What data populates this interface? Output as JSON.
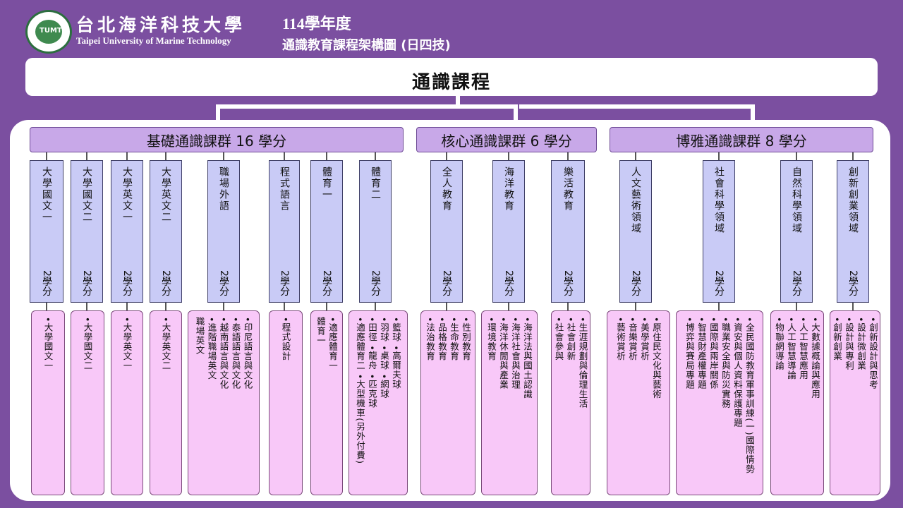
{
  "header": {
    "logo_text": "TUMT",
    "university_cn": "台北海洋科技大學",
    "university_en": "Taipei University of Marine Technology",
    "year": "114學年度",
    "subtitle": "通識教育課程架構圖 (日四技)"
  },
  "main_title": "通識課程",
  "categories": [
    {
      "label": "基礎通識課群 16 學分"
    },
    {
      "label": "核心通識課群 6 學分"
    },
    {
      "label": "博雅通識課群 8 學分"
    }
  ],
  "columns": [
    {
      "name": "大學國文一",
      "credit": "2學分",
      "courses": [
        "•大學國文一"
      ]
    },
    {
      "name": "大學國文二",
      "credit": "2學分",
      "courses": [
        "•大學國文二"
      ]
    },
    {
      "name": "大學英文一",
      "credit": "2學分",
      "courses": [
        "•大學英文一"
      ]
    },
    {
      "name": "大學英文二",
      "credit": "2學分",
      "courses": [
        "•大學英文二"
      ]
    },
    {
      "name": "職場外語",
      "credit": "2學分",
      "courses": [
        "•印尼語言與文化",
        "•泰語語言與文化",
        "•越南語言與文化",
        "•進階職場英文",
        "職場英文"
      ]
    },
    {
      "name": "程式語言",
      "credit": "2學分",
      "courses": [
        "•程式設計"
      ]
    },
    {
      "name": "體育一",
      "credit": "2學分",
      "courses": [
        "•適應體育一",
        "體育一"
      ]
    },
    {
      "name": "體育二",
      "credit": "2學分",
      "courses": [
        "•籃球 •高爾夫球",
        "•羽球 •桌球 •網球",
        "•田徑 •龍舟 •匹克球",
        "•適應體育二 •大型機車(另外付費)"
      ]
    },
    {
      "name": "全人教育",
      "credit": "2學分",
      "courses": [
        "•性別教育",
        "•生命教育",
        "•品格教育",
        "•法治教育"
      ]
    },
    {
      "name": "海洋教育",
      "credit": "2學分",
      "courses": [
        "•海洋法與國土認識",
        "•海洋社會與治理",
        "•海洋休閒與產業",
        "•環境教育"
      ]
    },
    {
      "name": "樂活教育",
      "credit": "2學分",
      "courses": [
        "•生涯規劃與倫理生活",
        "•社會創新",
        "•社會參與"
      ]
    },
    {
      "name": "人文藝術領域",
      "credit": "2學分",
      "courses": [
        "•原住民文化與藝術",
        "•美學賞析",
        "•音樂賞析",
        "•藝術賞析"
      ]
    },
    {
      "name": "社會科學領域",
      "credit": "2學分",
      "courses": [
        "•全民國防教育軍事訓練(一)國際情勢",
        "•資安與個人資料保護專題",
        "•職業安全與防災實務",
        "•國際與兩岸關係",
        "•智慧財產權專題",
        "•博弈與賽局專題"
      ]
    },
    {
      "name": "自然科學領域",
      "credit": "2學分",
      "courses": [
        "•大數據概論與應用",
        "•人工智慧應用",
        "•人工智慧導論",
        "•物聯網導論"
      ]
    },
    {
      "name": "創新創業領域",
      "credit": "2學分",
      "courses": [
        "•創新設計與思考",
        "•設計微創業",
        "•設計與專利",
        "•創新創業"
      ]
    }
  ]
}
